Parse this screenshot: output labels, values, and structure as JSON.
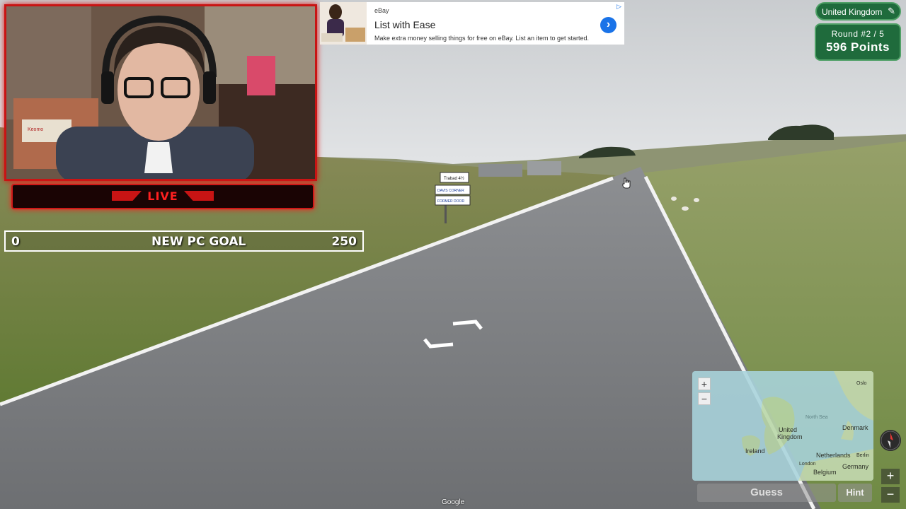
{
  "ad": {
    "source": "eBay",
    "title": "List with Ease",
    "description": "Make extra money selling things for free on eBay. List an item to get started."
  },
  "webcam": {
    "live_label": "LIVE",
    "banner_text": "Keomo"
  },
  "goal": {
    "start": "0",
    "label": "NEW PC GOAL",
    "end": "250"
  },
  "game": {
    "country": "United Kingdom",
    "round": "Round #2 / 5",
    "points": "596 Points",
    "guess_label": "Guess",
    "hint_label": "Hint"
  },
  "road_sign": {
    "line1": "Trabad 4½",
    "line2": "DAVIS CORNER",
    "line3": "FORMER DOOR"
  },
  "minimap": {
    "labels": [
      "United Kingdom",
      "Ireland",
      "Denmark",
      "Netherlands",
      "Belgium",
      "Germany",
      "London",
      "Berlin",
      "Oslo",
      "North Sea"
    ],
    "zoom_in": "+",
    "zoom_out": "−"
  },
  "controls": {
    "zoom_in": "+",
    "zoom_out": "−"
  },
  "watermark": "Google",
  "colors": {
    "accent_green": "#1f6b3c",
    "stream_red": "#c81414",
    "ad_blue": "#1a73e8"
  }
}
